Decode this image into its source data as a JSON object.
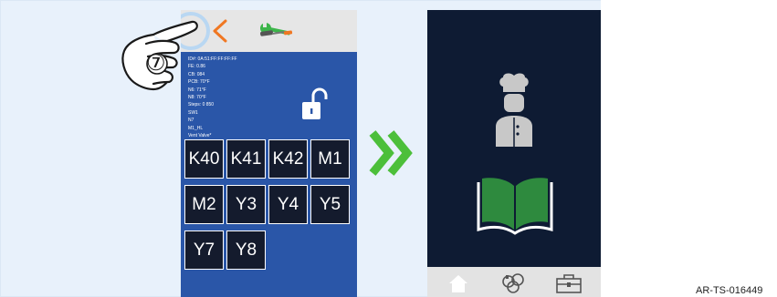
{
  "left_phone": {
    "diagnostics": [
      "ID#: 0A:51:FF:FF:FF:FF",
      "FE: 0.86",
      "CB: 084",
      "PCB: 70°F",
      "N6: 71°F",
      "N8: 70°F",
      "Steps: 0 850",
      "SW1",
      "N7",
      "M1_HL",
      "Vent Valve*"
    ],
    "grid_cells": [
      "K40",
      "K41",
      "K42",
      "M1",
      "M2",
      "Y3",
      "Y4",
      "Y5",
      "Y7",
      "Y8"
    ],
    "icons": [
      "back-chevron-icon",
      "service-tools-icon",
      "unlocked-padlock-icon"
    ],
    "step_marker": "⑦"
  },
  "right_phone": {
    "icons": [
      "chef-icon",
      "cookbook-icon",
      "home-icon",
      "dishes-icon",
      "toolbox-icon"
    ]
  },
  "reference_code": "AR-TS-016449",
  "colors": {
    "left_screen_bg": "#2a56a8",
    "right_screen_bg": "#0e1b33",
    "accent_orange": "#f07722",
    "accent_green": "#3cb54a",
    "book_green": "#2e8a3e",
    "cell_bg": "#141b2d"
  }
}
